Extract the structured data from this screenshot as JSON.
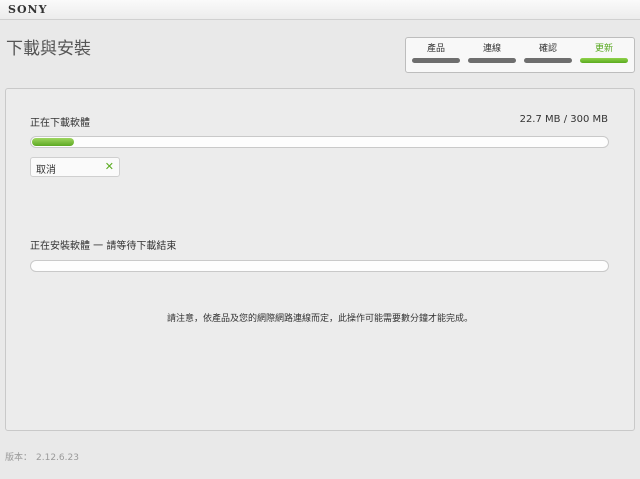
{
  "window": {
    "brand": "SONY"
  },
  "page": {
    "title": "下載與安裝"
  },
  "steps": [
    {
      "label": "產品",
      "active": false
    },
    {
      "label": "連線",
      "active": false
    },
    {
      "label": "確認",
      "active": false
    },
    {
      "label": "更新",
      "active": true
    }
  ],
  "download": {
    "label": "正在下載軟體",
    "size_text": "22.7 MB / 300 MB",
    "progress_fraction": 0.076,
    "cancel_label": "取消",
    "cancel_icon": "close-icon"
  },
  "install": {
    "label": "正在安裝軟體 一 請等待下載結束",
    "progress_fraction": 0
  },
  "notice": "請注意，依產品及您的網際網路連線而定，此操作可能需要數分鐘才能完成。",
  "footer": {
    "version_label": "版本：",
    "version_value": "2.12.6.23"
  },
  "colors": {
    "accent": "#5aab1f",
    "inactive_step": "#6e6e6e"
  }
}
